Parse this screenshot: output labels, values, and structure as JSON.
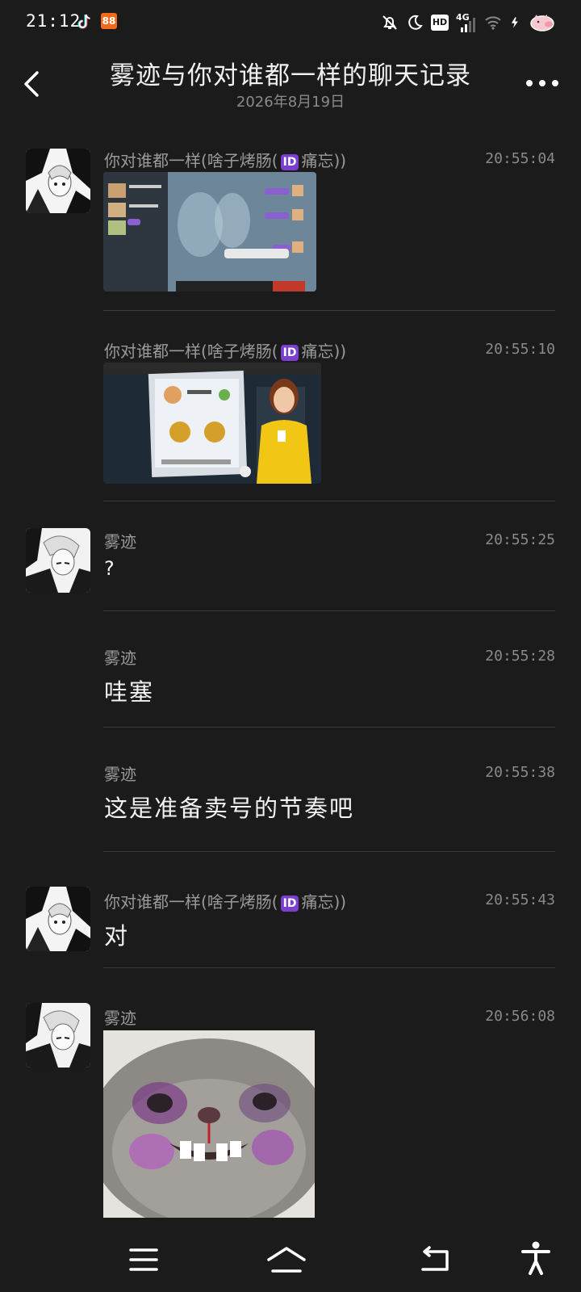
{
  "status_bar": {
    "time": "21:12",
    "network": "4G",
    "hd_label": "HD",
    "icons": [
      "tiktok-icon",
      "app-orange-icon",
      "bell-off-icon",
      "moon-icon",
      "hd-icon",
      "signal-4g-icon",
      "wifi-icon",
      "charging-icon",
      "pig-battery-icon"
    ]
  },
  "header": {
    "title": "雾迹与你对谁都一样的聊天记录",
    "date": "2026年8月19日"
  },
  "messages": [
    {
      "sender_prefix": "你对谁都一样(啥子烤肠(",
      "badge": "ID",
      "sender_suffix": "痛忘))",
      "time": "20:55:04",
      "type": "image",
      "image_desc": "game-screenshot-chat"
    },
    {
      "sender_prefix": "你对谁都一样(啥子烤肠(",
      "badge": "ID",
      "sender_suffix": "痛忘))",
      "time": "20:55:10",
      "type": "image",
      "image_desc": "game-screenshot-profile"
    },
    {
      "sender": "雾迹",
      "time": "20:55:25",
      "type": "text",
      "text": "?"
    },
    {
      "sender": "雾迹",
      "time": "20:55:28",
      "type": "text",
      "text": "哇塞"
    },
    {
      "sender": "雾迹",
      "time": "20:55:38",
      "type": "text",
      "text": "这是准备卖号的节奏吧"
    },
    {
      "sender_prefix": "你对谁都一样(啥子烤肠(",
      "badge": "ID",
      "sender_suffix": "痛忘))",
      "time": "20:55:43",
      "type": "text",
      "text": "对"
    },
    {
      "sender": "雾迹",
      "time": "20:56:08",
      "type": "image",
      "image_desc": "cat-meme-sticker"
    }
  ],
  "nav": {
    "icons": [
      "menu-icon",
      "home-icon",
      "back-icon",
      "accessibility-icon"
    ]
  },
  "colors": {
    "background": "#1b1b1b",
    "badge": "#7b3fcf",
    "divider": "#3a3a3a"
  }
}
